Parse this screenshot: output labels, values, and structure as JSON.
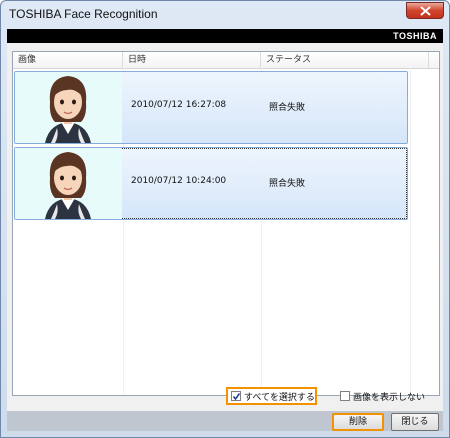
{
  "window": {
    "title": "TOSHIBA Face Recognition"
  },
  "brand": {
    "logo_text": "TOSHIBA"
  },
  "list": {
    "columns": [
      "画像",
      "日時",
      "ステータス"
    ],
    "rows": [
      {
        "image": "face-thumbnail",
        "datetime": "2010/07/12 16:27:08",
        "status": "照合失敗"
      },
      {
        "image": "face-thumbnail",
        "datetime": "2010/07/12 10:24:00",
        "status": "照合失敗"
      }
    ]
  },
  "options": {
    "select_all": {
      "label": "すべてを選択する",
      "checked": true
    },
    "hide_images": {
      "label": "画像を表示しない",
      "checked": false
    }
  },
  "buttons": {
    "delete": "削除",
    "close": "閉じる"
  },
  "colors": {
    "highlight": "#f39200",
    "row_border": "#84acdd"
  }
}
